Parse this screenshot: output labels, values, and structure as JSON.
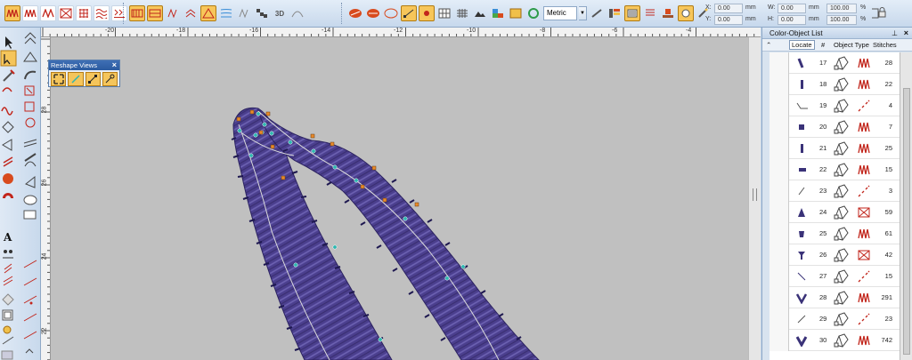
{
  "toolbar": {
    "units_select": "Metric",
    "coords": {
      "x_label": "X:",
      "x_value": "0.00",
      "x_unit": "mm",
      "y_label": "Y:",
      "y_value": "0.00",
      "y_unit": "mm",
      "w_label": "W:",
      "w_value": "0.00",
      "w_unit": "mm",
      "h_label": "H:",
      "h_value": "0.00",
      "h_unit": "mm",
      "sx_value": "100.00",
      "sx_unit": "%",
      "sy_value": "100.00",
      "sy_unit": "%"
    },
    "label_3d": "3D"
  },
  "ruler_top": [
    "-20",
    "-18",
    "-16",
    "-14",
    "-12",
    "-10",
    "-8",
    "-6",
    "-4"
  ],
  "ruler_left": [
    "28",
    "26",
    "24",
    "22"
  ],
  "reshape_views": {
    "title": "Reshape Views",
    "close": "×"
  },
  "color_object_list": {
    "title": "Color-Object List",
    "pin": "⊥",
    "close": "×",
    "columns": {
      "locate": "Locate",
      "num": "#",
      "type": "Object Type",
      "stitches": "Stitches"
    },
    "rows": [
      {
        "num": "17",
        "stitches": "28",
        "stitch": "satin"
      },
      {
        "num": "18",
        "stitches": "22",
        "stitch": "satin"
      },
      {
        "num": "19",
        "stitches": "4",
        "stitch": "run"
      },
      {
        "num": "20",
        "stitches": "7",
        "stitch": "satin"
      },
      {
        "num": "21",
        "stitches": "25",
        "stitch": "satin"
      },
      {
        "num": "22",
        "stitches": "15",
        "stitch": "satin"
      },
      {
        "num": "23",
        "stitches": "3",
        "stitch": "run"
      },
      {
        "num": "24",
        "stitches": "59",
        "stitch": "fill"
      },
      {
        "num": "25",
        "stitches": "61",
        "stitch": "satin"
      },
      {
        "num": "26",
        "stitches": "42",
        "stitch": "fill"
      },
      {
        "num": "27",
        "stitches": "15",
        "stitch": "run"
      },
      {
        "num": "28",
        "stitches": "291",
        "stitch": "satin"
      },
      {
        "num": "29",
        "stitches": "23",
        "stitch": "run"
      },
      {
        "num": "30",
        "stitches": "742",
        "stitch": "satin"
      }
    ]
  },
  "colors": {
    "stitch_purple": "#4b3f8e",
    "stitch_highlight": "#6d62b3",
    "node_teal": "#2fb7b0",
    "node_orange": "#e88a2a",
    "canvas_gray": "#c0c0c0"
  }
}
